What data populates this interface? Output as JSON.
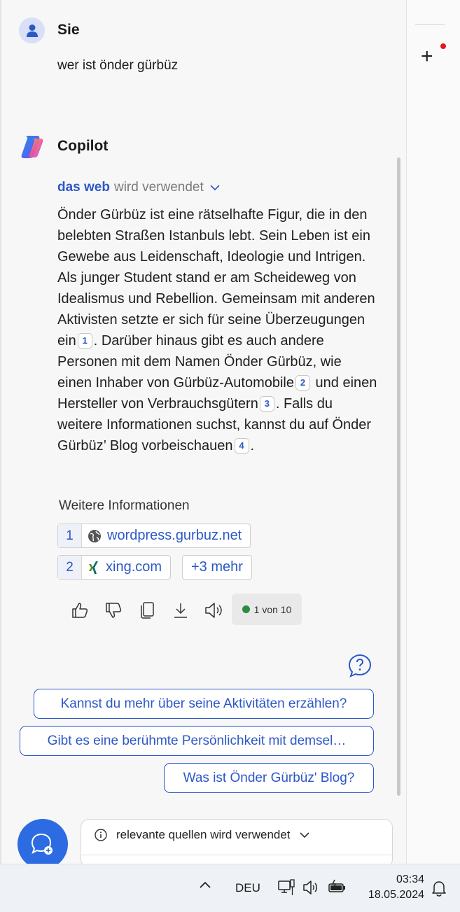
{
  "user": {
    "name": "Sie",
    "message": "wer ist önder gürbüz"
  },
  "copilot": {
    "name": "Copilot"
  },
  "source_status": {
    "bold": "das web",
    "rest": "wird verwendet"
  },
  "answer": {
    "p1": "Önder Gürbüz ist eine rätselhafte Figur, die in den belebten Straßen Istanbuls lebt. Sein Leben ist ein Gewebe aus Leidenschaft, Ideologie und Intrigen. Als junger Student stand er am Scheideweg von Idealismus und Rebellion. Gemeinsam mit anderen Aktivisten setzte er sich für seine Überzeugungen ein",
    "c1": "1",
    "p2": ". Darüber hinaus gibt es auch andere Personen mit dem Namen Önder Gürbüz, wie einen Inhaber von Gürbüz-Automobile",
    "c2": "2",
    "p3": " und einen Hersteller von Verbrauchsgütern",
    "c3": "3",
    "p4": ". Falls du weitere Informationen suchst, kannst du auf Önder Gürbüz’ Blog vorbeischauen",
    "c4": "4",
    "p5": "."
  },
  "more_info": {
    "title": "Weitere Informationen",
    "links": [
      {
        "num": "1",
        "label": "wordpress.gurbuz.net",
        "icon": "globe-icon"
      },
      {
        "num": "2",
        "label": "xing.com",
        "icon": "xing-icon"
      }
    ],
    "more": "+3 mehr"
  },
  "response_counter": "1 von 10",
  "suggestions": [
    "Kannst du mehr über seine Aktivitäten erzählen?",
    "Gibt es eine berühmte Persönlichkeit mit demsel…",
    "Was ist Önder Gürbüz' Blog?"
  ],
  "input_status": "relevante quellen wird verwendet",
  "taskbar": {
    "language": "DEU",
    "time": "03:34",
    "date": "18.05.2024"
  },
  "colors": {
    "accent": "#2c58c7",
    "new_topic": "#2d6be3",
    "notification_dot": "#e0161e",
    "status_green": "#2e8b3e"
  }
}
